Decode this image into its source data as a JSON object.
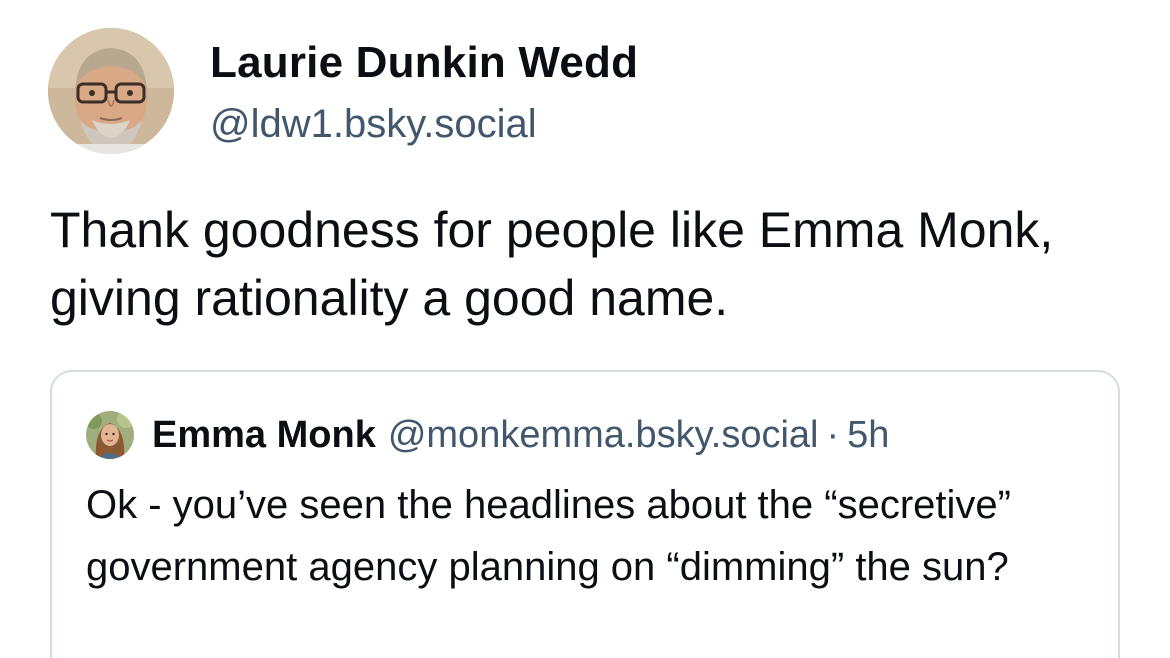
{
  "post": {
    "author": {
      "name": "Laurie Dunkin Wedd",
      "handle": "@ldw1.bsky.social",
      "avatar": "avatar-man-glasses-beard"
    },
    "text": "Thank goodness for people like Emma Monk, giving rationality a good name.",
    "quote": {
      "author": {
        "name": "Emma Monk",
        "handle": "@monkemma.bsky.social",
        "avatar": "avatar-woman"
      },
      "separator": "·",
      "time": "5h",
      "text": "Ok - you’ve seen the headlines about the “secretive” government agency planning on “dimming” the sun?"
    }
  },
  "colors": {
    "text_primary": "#0b0f14",
    "text_secondary": "#42576c",
    "card_border": "#d4dbe2",
    "background": "#ffffff"
  }
}
